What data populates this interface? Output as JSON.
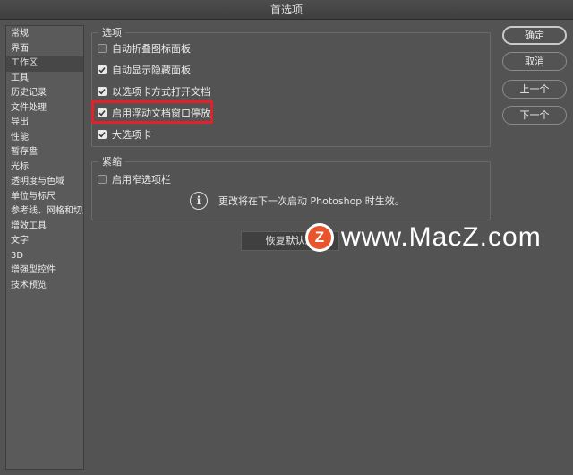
{
  "window": {
    "title": "首选项"
  },
  "sidebar": {
    "active_index": 2,
    "items": [
      {
        "label": "常规"
      },
      {
        "label": "界面"
      },
      {
        "label": "工作区"
      },
      {
        "label": "工具"
      },
      {
        "label": "历史记录"
      },
      {
        "label": "文件处理"
      },
      {
        "label": "导出"
      },
      {
        "label": "性能"
      },
      {
        "label": "暂存盘"
      },
      {
        "label": "光标"
      },
      {
        "label": "透明度与色域"
      },
      {
        "label": "单位与标尺"
      },
      {
        "label": "参考线、网格和切片"
      },
      {
        "label": "增效工具"
      },
      {
        "label": "文字"
      },
      {
        "label": "3D"
      },
      {
        "label": "增强型控件"
      },
      {
        "label": "技术预览"
      }
    ]
  },
  "options_group": {
    "title": "选项",
    "items": [
      {
        "label": "自动折叠图标面板",
        "checked": false
      },
      {
        "label": "自动显示隐藏面板",
        "checked": true
      },
      {
        "label": "以选项卡方式打开文档",
        "checked": true
      },
      {
        "label": "启用浮动文档窗口停放",
        "checked": true
      },
      {
        "label": "大选项卡",
        "checked": true
      }
    ]
  },
  "compact_group": {
    "title": "紧缩",
    "items": [
      {
        "label": "启用窄选项栏",
        "checked": false
      }
    ],
    "info_text": "更改将在下一次启动 Photoshop 时生效。"
  },
  "reset_button": {
    "label": "恢复默认工"
  },
  "buttons": {
    "ok": "确定",
    "cancel": "取消",
    "prev": "上一个",
    "next": "下一个"
  },
  "watermark": {
    "logo_letter": "Z",
    "text": "www.MacZ.com"
  },
  "colors": {
    "highlight": "#e0232a",
    "watermark_logo": "#e8542c",
    "panel": "#535353"
  },
  "icons": {
    "info": "info-circle-icon",
    "check": "checkmark-icon"
  }
}
